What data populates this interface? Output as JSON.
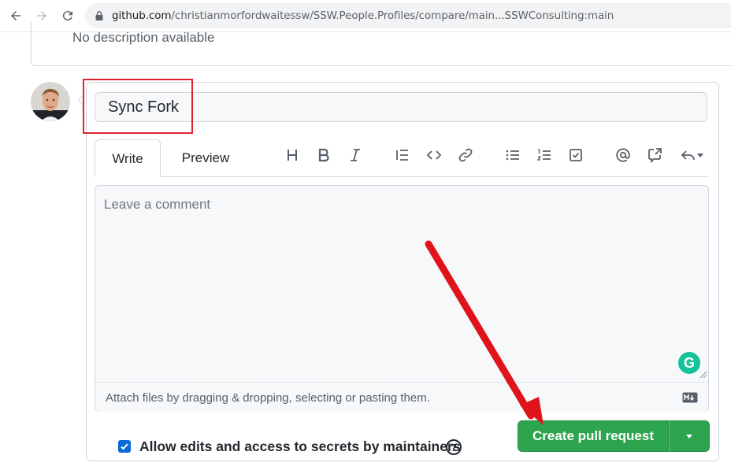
{
  "browser": {
    "url_host": "github.com",
    "url_path": "/christianmorfordwaitessw/SSW.People.Profiles/compare/main...SSWConsulting:main"
  },
  "previous": {
    "description": "No description available"
  },
  "pr_form": {
    "title_value": "Sync Fork",
    "tabs": [
      "Write",
      "Preview"
    ],
    "comment_placeholder": "Leave a comment",
    "attach_hint": "Attach files by dragging & dropping, selecting or pasting them.",
    "allow_edits_label": "Allow edits and access to secrets by maintainers",
    "allow_edits_checked": true,
    "create_button": "Create pull request",
    "help_glyph": "?",
    "grammarly_glyph": "G"
  },
  "toolbar_icons": [
    "heading-icon",
    "bold-icon",
    "italic-icon",
    "quote-icon",
    "code-icon",
    "link-icon",
    "unordered-list-icon",
    "ordered-list-icon",
    "task-list-icon",
    "mention-icon",
    "reference-icon",
    "reply-icon"
  ],
  "colors": {
    "primary_button": "#2da44e",
    "highlight_box": "#e0242b",
    "annotation_arrow": "#e0131b",
    "checkbox": "#0969da"
  }
}
